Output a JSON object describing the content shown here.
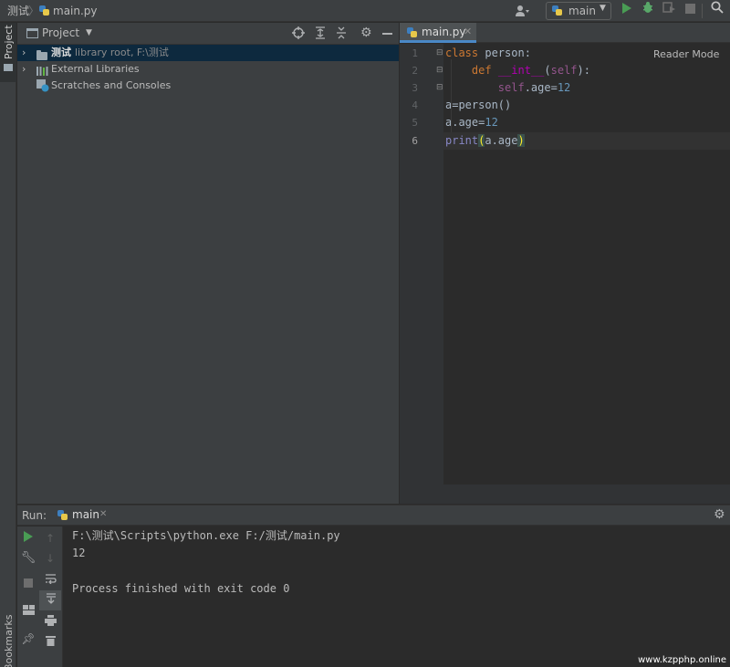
{
  "navbar": {
    "crumb_folder": "测试",
    "crumb_file": "main.py",
    "run_config": "main"
  },
  "left_stripe": {
    "project_tab": "Project",
    "bookmarks_tab": "Bookmarks"
  },
  "project": {
    "title": "Project",
    "tree": [
      {
        "name": "测试",
        "hint": "library root,  F:\\测试"
      },
      {
        "name": "External Libraries"
      },
      {
        "name": "Scratches and Consoles"
      }
    ]
  },
  "editor": {
    "tab_label": "main.py",
    "reader_mode": "Reader Mode",
    "line_numbers": [
      "1",
      "2",
      "3",
      "4",
      "5",
      "6"
    ]
  },
  "run": {
    "label": "Run:",
    "tab_label": "main",
    "console": [
      "F:\\测试\\Scripts\\python.exe F:/测试/main.py",
      "12",
      "",
      "Process finished with exit code 0"
    ]
  },
  "watermark": "www.kzpphp.online",
  "colors": {
    "keyword": "#cc7832",
    "dunder": "#b200b2",
    "self": "#94558d",
    "number": "#6897bb",
    "builtin": "#8888c6",
    "run_green": "#499c54",
    "debug_green": "#59a869",
    "selection": "#0d293e",
    "tab_underline": "#4a88c7"
  }
}
